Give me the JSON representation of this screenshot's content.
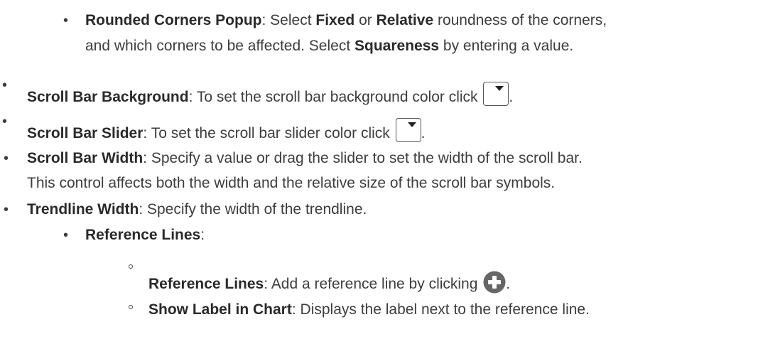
{
  "items": {
    "rounded": {
      "t1": "Rounded Corners Popup",
      "t2": ": Select ",
      "t3": "Fixed",
      "t4": " or ",
      "t5": "Relative",
      "t6": " roundness of the corners,",
      "t7": "and which corners to be affected. Select ",
      "t8": "Squareness",
      "t9": " by entering a value."
    },
    "scroll_bg": {
      "t1": "Scroll Bar Background",
      "t2": ": To set the scroll bar background color click ",
      "t3": "."
    },
    "scroll_slider": {
      "t1": "Scroll Bar Slider",
      "t2": ": To set the scroll bar slider color click ",
      "t3": "."
    },
    "scroll_width": {
      "t1": "Scroll Bar Width",
      "t2": ": Specify a value or drag the slider to set the width of the scroll bar.",
      "t3": "This control affects both the width and the relative size of the scroll bar symbols."
    },
    "trendline": {
      "t1": "Trendline Width",
      "t2": ": Specify the width of the trendline."
    },
    "ref_lines_heading": {
      "t1": "Reference Lines",
      "t2": ":"
    },
    "ref_lines": {
      "t1": "Reference Lines",
      "t2": ": Add a reference line by clicking ",
      "t3": "."
    },
    "show_label": {
      "t1": "Show Label in Chart",
      "t2": ": Displays the label next to the reference line."
    }
  },
  "bullet_char": "•",
  "icons": {
    "color_picker": "color-picker-dropdown-icon",
    "add": "add-plus-icon"
  },
  "colors": {
    "text": "#3d3d3d",
    "add_icon": "#666666"
  }
}
